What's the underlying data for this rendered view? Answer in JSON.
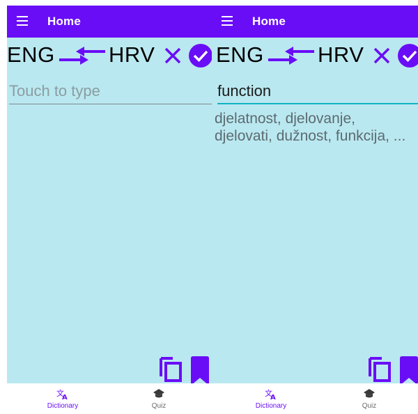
{
  "colors": {
    "primary": "#6a0df7",
    "background": "#bae8f0",
    "input_underline_active": "#10b3c2",
    "text_primary": "#000000",
    "text_secondary": "#5c6b70"
  },
  "appbar": {
    "menu_icon": "hamburger-menu-icon",
    "title": "Home"
  },
  "language_bar": {
    "source_lang": "ENG",
    "target_lang": "HRV",
    "swap_icon": "swap-arrows-icon",
    "clear_icon": "close-x-icon",
    "confirm_icon": "check-circle-icon"
  },
  "screens": [
    {
      "input_value": "",
      "input_placeholder": "Touch to type",
      "results": ""
    },
    {
      "input_value": "function",
      "input_placeholder": "Touch to type",
      "results": "djelatnost, djelovanje, djelovati, dužnost, funkcija, ..."
    }
  ],
  "actions": {
    "copy_icon": "copy-icon",
    "bookmark_icon": "bookmark-icon"
  },
  "bottom_nav": {
    "items": [
      {
        "label": "Dictionary",
        "icon": "translate-icon",
        "active": true
      },
      {
        "label": "Quiz",
        "icon": "graduation-cap-icon",
        "active": false
      }
    ]
  }
}
